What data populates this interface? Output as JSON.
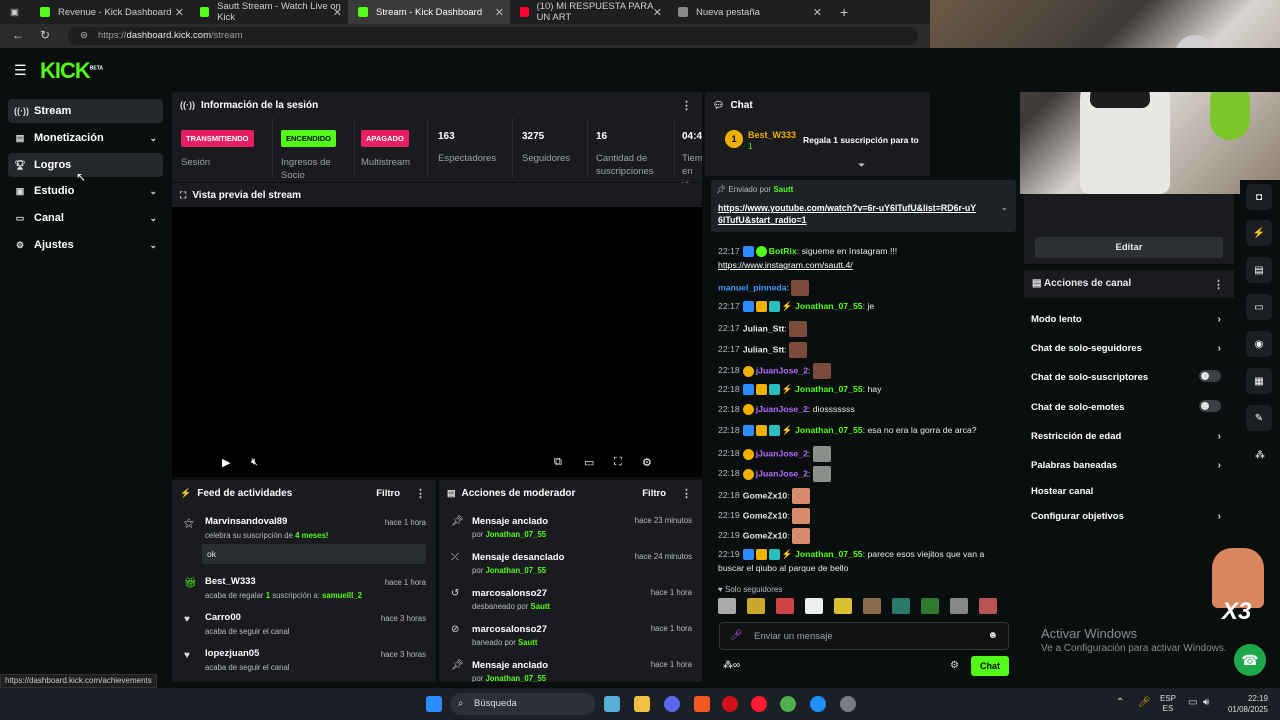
{
  "browser": {
    "tabs": [
      {
        "label": "Revenue - Kick Dashboard",
        "color": "#53fc18"
      },
      {
        "label": "Sautt Stream - Watch Live on Kick",
        "color": "#53fc18"
      },
      {
        "label": "Stream - Kick Dashboard",
        "color": "#53fc18"
      },
      {
        "label": "(10) MI RESPUESTA PARA UN ART",
        "color": "#ff0033"
      },
      {
        "label": "Nueva pestaña",
        "color": "#888888"
      }
    ],
    "url_prefix": "https://",
    "url_host": "dashboard.kick.com",
    "url_path": "/stream"
  },
  "app": {
    "logo": "KICK",
    "logo_badge": "BETA"
  },
  "sidebar": {
    "items": [
      {
        "label": "Stream",
        "icon": "stream-icon"
      },
      {
        "label": "Monetización",
        "icon": "dollar-icon"
      },
      {
        "label": "Logros",
        "icon": "trophy-icon"
      },
      {
        "label": "Estudio",
        "icon": "studio-icon"
      },
      {
        "label": "Canal",
        "icon": "channel-icon"
      },
      {
        "label": "Ajustes",
        "icon": "gear-icon"
      }
    ]
  },
  "session": {
    "title": "Información de la sesión",
    "badges": [
      {
        "text": "TRANSMITIENDO",
        "label": "Sesión",
        "bg": "#e91e63"
      },
      {
        "text": "ENCENDIDO",
        "label": "Ingresos de Socio",
        "bg": "#53fc18"
      },
      {
        "text": "APAGADO",
        "label": "Multistream",
        "bg": "#e91e63"
      }
    ],
    "stats": [
      {
        "value": "163",
        "label": "Espectadores"
      },
      {
        "value": "3275",
        "label": "Seguidores"
      },
      {
        "value": "16",
        "label": "Cantidad de suscripciones"
      },
      {
        "value": "04:4",
        "label": "Tiem en vi"
      }
    ]
  },
  "preview": {
    "title": "Vista previa del stream"
  },
  "feed": {
    "title": "Feed de actividades",
    "filter": "Filtro",
    "items": [
      {
        "name": "Marvinsandoval89",
        "sub_a": "celebra su suscripción de ",
        "sub_b": "4 meses!",
        "time": "hace 1 hora",
        "note": "ok"
      },
      {
        "name": "Best_W333",
        "sub_a": "acaba de regalar ",
        "sub_b": "1",
        "sub_c": " suscripción a: ",
        "sub_d": "samuelll_2",
        "time": "hace 1 hora"
      },
      {
        "name": "Carro00",
        "sub_a": "acaba de seguir el canal",
        "time": "hace 3 horas"
      },
      {
        "name": "lopezjuan05",
        "sub_a": "acaba de seguir el canal",
        "time": "hace 3 horas"
      }
    ]
  },
  "mod": {
    "title": "Acciones de moderador",
    "filter": "Filtro",
    "items": [
      {
        "action": "Mensaje anclado",
        "by": "por ",
        "user": "Jonathan_07_55",
        "time": "hace 23 minutos"
      },
      {
        "action": "Mensaje desanclado",
        "by": "por ",
        "user": "Jonathan_07_55",
        "time": "hace 24 minutos"
      },
      {
        "action": "marcosalonso27",
        "by": "desbaneado por ",
        "user": "Sautt",
        "time": "hace 1 hora"
      },
      {
        "action": "marcosalonso27",
        "by": "baneado por ",
        "user": "Sautt",
        "time": "hace 1 hora"
      },
      {
        "action": "Mensaje anclado",
        "by": "por ",
        "user": "Jonathan_07_55",
        "time": "hace 1 hora"
      }
    ]
  },
  "chat": {
    "title": "Chat",
    "gifter": "Best_W333",
    "gifter_count": "1",
    "gift_text": "Regala 1 suscripción para to",
    "pinned_by_label": "Enviado por",
    "pinned_by": "Sautt",
    "pinned_link": "https://www.youtube.com/watch?v=6r-uY6lTufU&list=RD6r-uY6lTufU&start_radio=1",
    "messages": [
      {
        "time": "22:17",
        "user": "BotRix",
        "color": "#53fc18",
        "text": "sigueme en Instagram !!!",
        "link": "https://www.instagram.com/sautt.4/"
      },
      {
        "time": "",
        "user": "manuel_pinneda",
        "color": "#3b9bff",
        "text": ""
      },
      {
        "time": "22:17",
        "user": "Jonathan_07_55",
        "color": "#53fc18",
        "text": "je"
      },
      {
        "time": "22:17",
        "user": "Julian_Stt",
        "color": "#ffffff",
        "text": ""
      },
      {
        "time": "22:17",
        "user": "Julian_Stt",
        "color": "#ffffff",
        "text": ""
      },
      {
        "time": "22:18",
        "user": "jJuanJose_2",
        "color": "#b46cff",
        "text": ""
      },
      {
        "time": "22:18",
        "user": "Jonathan_07_55",
        "color": "#53fc18",
        "text": "hay"
      },
      {
        "time": "22:18",
        "user": "jJuanJose_2",
        "color": "#b46cff",
        "text": "diosssssss"
      },
      {
        "time": "22:18",
        "user": "Jonathan_07_55",
        "color": "#53fc18",
        "text": "esa no era la gorra de arca?"
      },
      {
        "time": "22:18",
        "user": "jJuanJose_2",
        "color": "#b46cff",
        "text": ""
      },
      {
        "time": "22:18",
        "user": "jJuanJose_2",
        "color": "#b46cff",
        "text": ""
      },
      {
        "time": "22:18",
        "user": "GomeZx10",
        "color": "#ffffff",
        "text": ""
      },
      {
        "time": "22:19",
        "user": "GomeZx10",
        "color": "#ffffff",
        "text": ""
      },
      {
        "time": "22:19",
        "user": "GomeZx10",
        "color": "#ffffff",
        "text": ""
      },
      {
        "time": "22:19",
        "user": "Jonathan_07_55",
        "color": "#53fc18",
        "text": "parece esos viejitos que van a",
        "text2": "buscar el qiubo al parque de bello"
      }
    ],
    "followers_only": "Solo seguidores",
    "input_placeholder": "Enviar un mensaje",
    "send_label": "Chat"
  },
  "channel_actions": {
    "edit_label": "Editar",
    "title": "Acciones de canal",
    "items": [
      {
        "label": "Modo lento",
        "kind": "arrow"
      },
      {
        "label": "Chat de solo-seguidores",
        "kind": "arrow"
      },
      {
        "label": "Chat de solo-suscriptores",
        "kind": "toggle"
      },
      {
        "label": "Chat de solo-emotes",
        "kind": "toggle"
      },
      {
        "label": "Restricción de edad",
        "kind": "arrow"
      },
      {
        "label": "Palabras baneadas",
        "kind": "arrow"
      },
      {
        "label": "Hostear canal",
        "kind": "none"
      },
      {
        "label": "Configurar objetivos",
        "kind": "arrow"
      }
    ]
  },
  "windows": {
    "activate_title": "Activar Windows",
    "activate_sub": "Ve a Configuración para activar Windows.",
    "search_placeholder": "Búsqueda",
    "lang_a": "ESP",
    "lang_b": "ES",
    "time": "22:19",
    "date": "01/08/2025",
    "status_url": "https://dashboard.kick.com/achievements",
    "overlay_badge": "X3"
  }
}
